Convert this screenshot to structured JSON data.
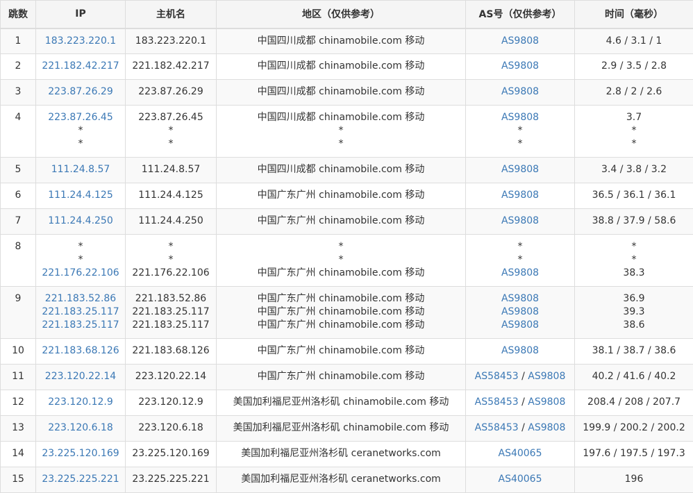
{
  "headers": [
    "跳数",
    "IP",
    "主机名",
    "地区（仅供参考）",
    "AS号（仅供参考）",
    "时间（毫秒）"
  ],
  "colors": {
    "link": "#3b78b5",
    "text": "#333333",
    "border": "#dddddd",
    "header_bg": "#f5f5f5",
    "zebra_bg": "#f9f9f9"
  },
  "rows": [
    {
      "hop": "1",
      "entries": [
        {
          "ip": "183.223.220.1",
          "host": "183.223.220.1",
          "region": "中国四川成都 chinamobile.com 移动",
          "as": [
            "AS9808"
          ],
          "time": "4.6 / 3.1 / 1"
        }
      ]
    },
    {
      "hop": "2",
      "entries": [
        {
          "ip": "221.182.42.217",
          "host": "221.182.42.217",
          "region": "中国四川成都 chinamobile.com 移动",
          "as": [
            "AS9808"
          ],
          "time": "2.9 / 3.5 / 2.8"
        }
      ]
    },
    {
      "hop": "3",
      "entries": [
        {
          "ip": "223.87.26.29",
          "host": "223.87.26.29",
          "region": "中国四川成都 chinamobile.com 移动",
          "as": [
            "AS9808"
          ],
          "time": "2.8 / 2 / 2.6"
        }
      ]
    },
    {
      "hop": "4",
      "entries": [
        {
          "ip": "223.87.26.45",
          "host": "223.87.26.45",
          "region": "中国四川成都 chinamobile.com 移动",
          "as": [
            "AS9808"
          ],
          "time": "3.7"
        },
        {
          "ip": "*",
          "host": "*",
          "region": "*",
          "as": [
            "*"
          ],
          "time": "*"
        },
        {
          "ip": "*",
          "host": "*",
          "region": "*",
          "as": [
            "*"
          ],
          "time": "*"
        }
      ]
    },
    {
      "hop": "5",
      "entries": [
        {
          "ip": "111.24.8.57",
          "host": "111.24.8.57",
          "region": "中国四川成都 chinamobile.com 移动",
          "as": [
            "AS9808"
          ],
          "time": "3.4 / 3.8 / 3.2"
        }
      ]
    },
    {
      "hop": "6",
      "entries": [
        {
          "ip": "111.24.4.125",
          "host": "111.24.4.125",
          "region": "中国广东广州 chinamobile.com 移动",
          "as": [
            "AS9808"
          ],
          "time": "36.5 / 36.1 / 36.1"
        }
      ]
    },
    {
      "hop": "7",
      "entries": [
        {
          "ip": "111.24.4.250",
          "host": "111.24.4.250",
          "region": "中国广东广州 chinamobile.com 移动",
          "as": [
            "AS9808"
          ],
          "time": "38.8 / 37.9 / 58.6"
        }
      ]
    },
    {
      "hop": "8",
      "entries": [
        {
          "ip": "*",
          "host": "*",
          "region": "*",
          "as": [
            "*"
          ],
          "time": "*"
        },
        {
          "ip": "*",
          "host": "*",
          "region": "*",
          "as": [
            "*"
          ],
          "time": "*"
        },
        {
          "ip": "221.176.22.106",
          "host": "221.176.22.106",
          "region": "中国广东广州 chinamobile.com 移动",
          "as": [
            "AS9808"
          ],
          "time": "38.3"
        }
      ]
    },
    {
      "hop": "9",
      "entries": [
        {
          "ip": "221.183.52.86",
          "host": "221.183.52.86",
          "region": "中国广东广州 chinamobile.com 移动",
          "as": [
            "AS9808"
          ],
          "time": "36.9"
        },
        {
          "ip": "221.183.25.117",
          "host": "221.183.25.117",
          "region": "中国广东广州 chinamobile.com 移动",
          "as": [
            "AS9808"
          ],
          "time": "39.3"
        },
        {
          "ip": "221.183.25.117",
          "host": "221.183.25.117",
          "region": "中国广东广州 chinamobile.com 移动",
          "as": [
            "AS9808"
          ],
          "time": "38.6"
        }
      ]
    },
    {
      "hop": "10",
      "entries": [
        {
          "ip": "221.183.68.126",
          "host": "221.183.68.126",
          "region": "中国广东广州 chinamobile.com 移动",
          "as": [
            "AS9808"
          ],
          "time": "38.1 / 38.7 / 38.6"
        }
      ]
    },
    {
      "hop": "11",
      "entries": [
        {
          "ip": "223.120.22.14",
          "host": "223.120.22.14",
          "region": "中国广东广州 chinamobile.com 移动",
          "as": [
            "AS58453",
            "AS9808"
          ],
          "time": "40.2 / 41.6 / 40.2"
        }
      ]
    },
    {
      "hop": "12",
      "entries": [
        {
          "ip": "223.120.12.9",
          "host": "223.120.12.9",
          "region": "美国加利福尼亚州洛杉矶 chinamobile.com 移动",
          "as": [
            "AS58453",
            "AS9808"
          ],
          "time": "208.4 / 208 / 207.7"
        }
      ]
    },
    {
      "hop": "13",
      "entries": [
        {
          "ip": "223.120.6.18",
          "host": "223.120.6.18",
          "region": "美国加利福尼亚州洛杉矶 chinamobile.com 移动",
          "as": [
            "AS58453",
            "AS9808"
          ],
          "time": "199.9 / 200.2 / 200.2"
        }
      ]
    },
    {
      "hop": "14",
      "entries": [
        {
          "ip": "23.225.120.169",
          "host": "23.225.120.169",
          "region": "美国加利福尼亚州洛杉矶 ceranetworks.com",
          "as": [
            "AS40065"
          ],
          "time": "197.6 / 197.5 / 197.3"
        }
      ]
    },
    {
      "hop": "15",
      "entries": [
        {
          "ip": "23.225.225.221",
          "host": "23.225.225.221",
          "region": "美国加利福尼亚州洛杉矶 ceranetworks.com",
          "as": [
            "AS40065"
          ],
          "time": "196"
        }
      ]
    }
  ]
}
